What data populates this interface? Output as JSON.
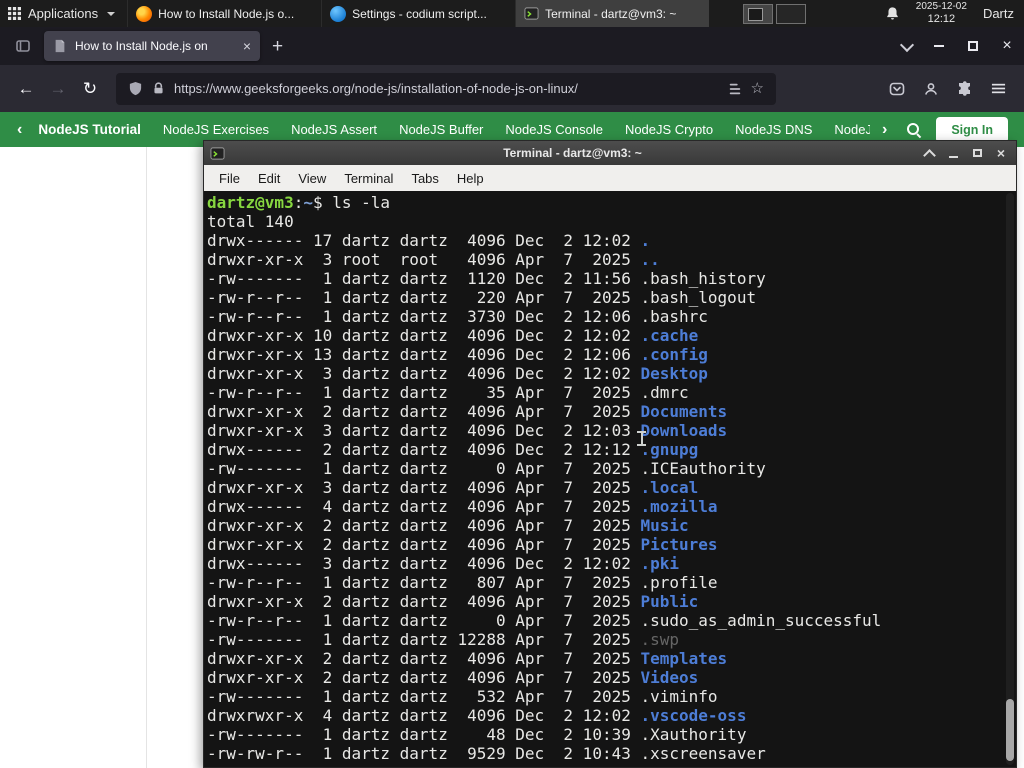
{
  "panel": {
    "applications_label": "Applications",
    "windows": [
      {
        "label": "How to Install Node.js o...",
        "app": "firefox"
      },
      {
        "label": "Settings - codium script...",
        "app": "codium"
      },
      {
        "label": "Terminal - dartz@vm3: ~",
        "app": "terminal",
        "active": true
      }
    ],
    "clock": {
      "date": "2025-12-02",
      "time": "12:12"
    },
    "user": "Dartz"
  },
  "browser": {
    "tab_title": "How to Install Node.js on",
    "url": "https://www.geeksforgeeks.org/node-js/installation-of-node-js-on-linux/"
  },
  "icons": {
    "back": "←",
    "forward": "→",
    "reload": "↻",
    "star": "☆",
    "tab_close": "×",
    "new_tab": "+",
    "window_close": "×",
    "terminal_close": "×",
    "nav_left": "‹",
    "nav_right": "›"
  },
  "gfg_nav": {
    "accent": "#2f8d46",
    "items": [
      "NodeJS Tutorial",
      "NodeJS Exercises",
      "NodeJS Assert",
      "NodeJS Buffer",
      "NodeJS Console",
      "NodeJS Crypto",
      "NodeJS DNS",
      "NodeJS"
    ],
    "sign_in": "Sign In"
  },
  "terminal": {
    "title": "Terminal - dartz@vm3: ~",
    "menus": [
      "File",
      "Edit",
      "View",
      "Terminal",
      "Tabs",
      "Help"
    ],
    "prompt": {
      "user_host": "dartz@vm3",
      "colon": ":",
      "path": "~",
      "dollar": "$",
      "command": "ls -la"
    },
    "total_line": "total 140",
    "colors": {
      "bg": "#141414",
      "fg": "#e8e8e6",
      "prompt_green": "#87d740",
      "dir_blue": "#4d7dd6",
      "dim": "#666666"
    },
    "listing": [
      {
        "pre": "drwx------ 17 dartz dartz  4096 Dec  2 12:02 ",
        "name": ".",
        "type": "dir"
      },
      {
        "pre": "drwxr-xr-x  3 root  root   4096 Apr  7  2025 ",
        "name": "..",
        "type": "dir"
      },
      {
        "pre": "-rw-------  1 dartz dartz  1120 Dec  2 11:56 ",
        "name": ".bash_history",
        "type": "file"
      },
      {
        "pre": "-rw-r--r--  1 dartz dartz   220 Apr  7  2025 ",
        "name": ".bash_logout",
        "type": "file"
      },
      {
        "pre": "-rw-r--r--  1 dartz dartz  3730 Dec  2 12:06 ",
        "name": ".bashrc",
        "type": "file"
      },
      {
        "pre": "drwxr-xr-x 10 dartz dartz  4096 Dec  2 12:02 ",
        "name": ".cache",
        "type": "dir"
      },
      {
        "pre": "drwxr-xr-x 13 dartz dartz  4096 Dec  2 12:06 ",
        "name": ".config",
        "type": "dir"
      },
      {
        "pre": "drwxr-xr-x  3 dartz dartz  4096 Dec  2 12:02 ",
        "name": "Desktop",
        "type": "dir"
      },
      {
        "pre": "-rw-r--r--  1 dartz dartz    35 Apr  7  2025 ",
        "name": ".dmrc",
        "type": "file"
      },
      {
        "pre": "drwxr-xr-x  2 dartz dartz  4096 Apr  7  2025 ",
        "name": "Documents",
        "type": "dir"
      },
      {
        "pre": "drwxr-xr-x  3 dartz dartz  4096 Dec  2 12:03 ",
        "name": "Downloads",
        "type": "dir"
      },
      {
        "pre": "drwx------  2 dartz dartz  4096 Dec  2 12:12 ",
        "name": ".gnupg",
        "type": "dir"
      },
      {
        "pre": "-rw-------  1 dartz dartz     0 Apr  7  2025 ",
        "name": ".ICEauthority",
        "type": "file"
      },
      {
        "pre": "drwxr-xr-x  3 dartz dartz  4096 Apr  7  2025 ",
        "name": ".local",
        "type": "dir"
      },
      {
        "pre": "drwx------  4 dartz dartz  4096 Apr  7  2025 ",
        "name": ".mozilla",
        "type": "dir"
      },
      {
        "pre": "drwxr-xr-x  2 dartz dartz  4096 Apr  7  2025 ",
        "name": "Music",
        "type": "dir"
      },
      {
        "pre": "drwxr-xr-x  2 dartz dartz  4096 Apr  7  2025 ",
        "name": "Pictures",
        "type": "dir"
      },
      {
        "pre": "drwx------  3 dartz dartz  4096 Dec  2 12:02 ",
        "name": ".pki",
        "type": "dir"
      },
      {
        "pre": "-rw-r--r--  1 dartz dartz   807 Apr  7  2025 ",
        "name": ".profile",
        "type": "file"
      },
      {
        "pre": "drwxr-xr-x  2 dartz dartz  4096 Apr  7  2025 ",
        "name": "Public",
        "type": "dir"
      },
      {
        "pre": "-rw-r--r--  1 dartz dartz     0 Apr  7  2025 ",
        "name": ".sudo_as_admin_successful",
        "type": "file"
      },
      {
        "pre": "-rw-------  1 dartz dartz 12288 Apr  7  2025 ",
        "name": ".swp",
        "type": "dim"
      },
      {
        "pre": "drwxr-xr-x  2 dartz dartz  4096 Apr  7  2025 ",
        "name": "Templates",
        "type": "dir"
      },
      {
        "pre": "drwxr-xr-x  2 dartz dartz  4096 Apr  7  2025 ",
        "name": "Videos",
        "type": "dir"
      },
      {
        "pre": "-rw-------  1 dartz dartz   532 Apr  7  2025 ",
        "name": ".viminfo",
        "type": "file"
      },
      {
        "pre": "drwxrwxr-x  4 dartz dartz  4096 Dec  2 12:02 ",
        "name": ".vscode-oss",
        "type": "dir"
      },
      {
        "pre": "-rw-------  1 dartz dartz    48 Dec  2 10:39 ",
        "name": ".Xauthority",
        "type": "file"
      },
      {
        "pre": "-rw-rw-r--  1 dartz dartz  9529 Dec  2 10:43 ",
        "name": ".xscreensaver",
        "type": "file"
      }
    ]
  }
}
